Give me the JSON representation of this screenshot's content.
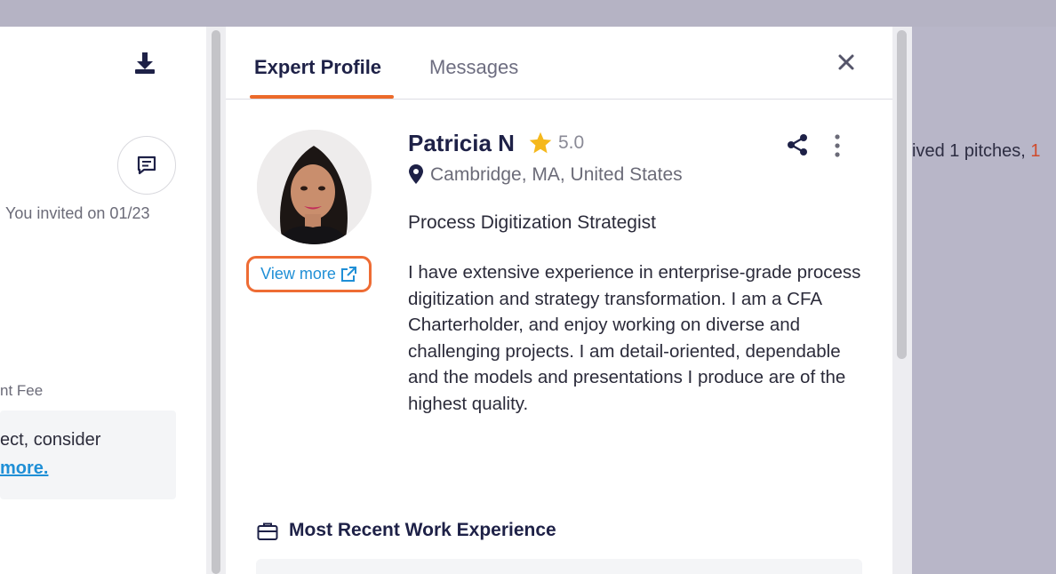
{
  "left_page": {
    "invited_text": "You invited on 01/23",
    "fee_label": "nt Fee",
    "note_text": "ect, consider",
    "note_link": "more."
  },
  "overlay": {
    "text_prefix": "ived 1 pitches, ",
    "text_highlight": "1"
  },
  "panel": {
    "tabs": [
      {
        "label": "Expert Profile",
        "active": true
      },
      {
        "label": "Messages",
        "active": false
      }
    ],
    "profile": {
      "name": "Patricia N",
      "rating": "5.0",
      "location": "Cambridge, MA, United States",
      "headline": "Process Digitization Strategist",
      "view_more_label": "View more",
      "bio": "I have extensive experience in enterprise-grade process digitization and strategy transformation. I am a CFA Charterholder, and enjoy working on diverse and challenging projects. I am detail-oriented, dependable and the models and presentations I produce are of the highest quality."
    },
    "work_section_title": "Most Recent Work Experience"
  },
  "icons": {
    "download": "download-icon",
    "chat": "chat-icon",
    "close": "close-icon",
    "star": "star-icon",
    "share": "share-icon",
    "more": "more-vertical-icon",
    "location": "location-pin-icon",
    "external_link": "external-link-icon",
    "briefcase": "briefcase-icon"
  },
  "colors": {
    "accent_orange": "#ec6a2a",
    "link_blue": "#1f8fd6",
    "star_yellow": "#f5b81c",
    "navy_text": "#1e2147",
    "overlay": "#b8b6c8"
  }
}
